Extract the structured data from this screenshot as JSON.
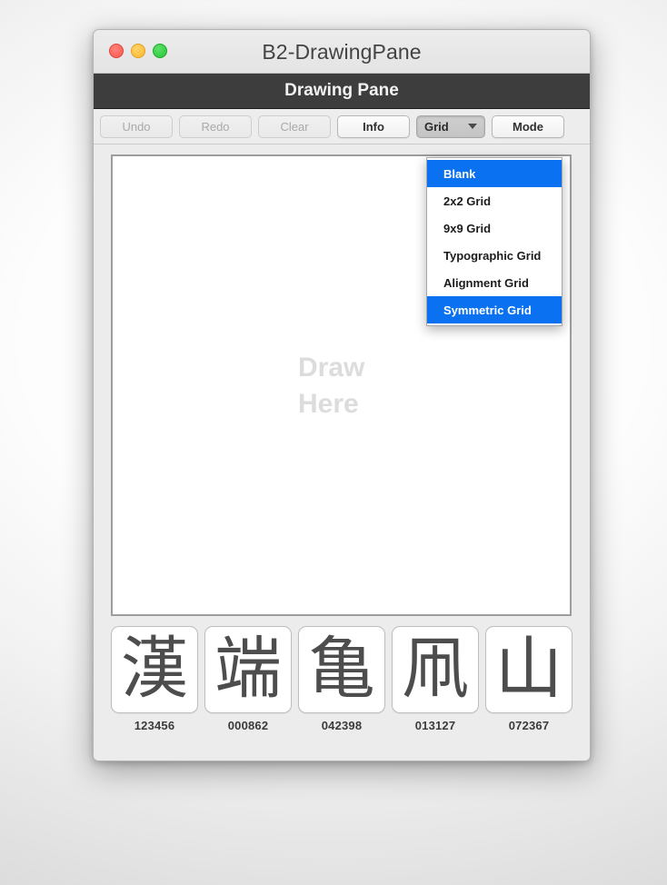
{
  "window": {
    "title": "B2-DrawingPane",
    "traffic_lights": [
      {
        "name": "close",
        "color": "#fb5951"
      },
      {
        "name": "minimize",
        "color": "#fdb72b"
      },
      {
        "name": "zoom",
        "color": "#23c534"
      }
    ]
  },
  "app_header": {
    "title": "Drawing Pane",
    "background": "#3d3d3d"
  },
  "toolbar": {
    "buttons": [
      {
        "label": "Undo",
        "state": "disabled"
      },
      {
        "label": "Redo",
        "state": "disabled"
      },
      {
        "label": "Clear",
        "state": "disabled"
      },
      {
        "label": "Info",
        "state": "enabled"
      },
      {
        "label": "Grid",
        "state": "pressed",
        "has_caret": true
      },
      {
        "label": "Mode",
        "state": "enabled"
      }
    ]
  },
  "canvas": {
    "placeholder": "Draw\nHere",
    "placeholder_color": "#dcdcdc",
    "background": "#ffffff"
  },
  "grid_menu": {
    "open": true,
    "highlight_color": "#0a72f0",
    "items": [
      {
        "label": "Blank",
        "selected": true
      },
      {
        "label": "2x2 Grid",
        "selected": false
      },
      {
        "label": "9x9 Grid",
        "selected": false
      },
      {
        "label": "Typographic Grid",
        "selected": false
      },
      {
        "label": "Alignment Grid",
        "selected": false
      },
      {
        "label": "Symmetric Grid",
        "selected": true
      }
    ]
  },
  "thumbnails": [
    {
      "glyph": "漢",
      "code": "123456"
    },
    {
      "glyph": "端",
      "code": "000862"
    },
    {
      "glyph": "亀",
      "code": "042398"
    },
    {
      "glyph": "凧",
      "code": "013127"
    },
    {
      "glyph": "山",
      "code": "072367"
    }
  ]
}
